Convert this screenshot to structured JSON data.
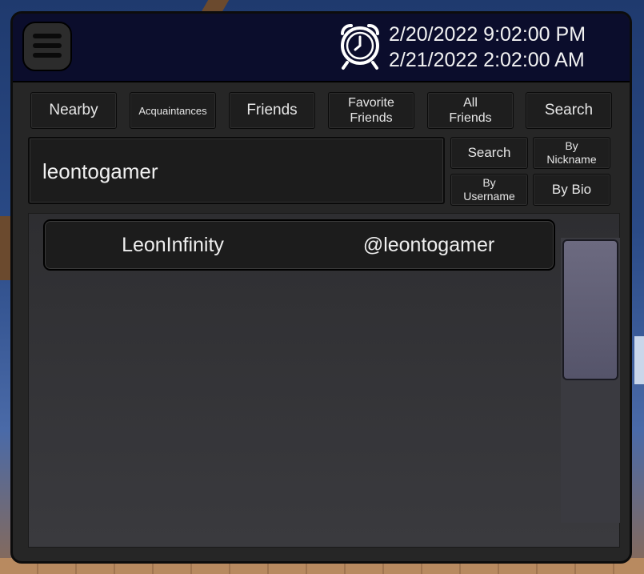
{
  "header": {
    "date_line_1": "2/20/2022 9:02:00 PM",
    "date_line_2": "2/21/2022 2:02:00 AM",
    "menu_icon": "hamburger-menu-icon",
    "clock_icon": "alarm-clock-icon"
  },
  "tabs": {
    "nearby": "Nearby",
    "acquaintances": "Acquaintances",
    "friends": "Friends",
    "favorite_friends_1": "Favorite",
    "favorite_friends_2": "Friends",
    "all_friends_1": "All",
    "all_friends_2": "Friends",
    "search": "Search"
  },
  "search": {
    "value": "leontogamer",
    "search_button": "Search",
    "by_nickname_1": "By",
    "by_nickname_2": "Nickname",
    "by_username_1": "By",
    "by_username_2": "Username",
    "by_bio": "By Bio"
  },
  "results": [
    {
      "nickname": "LeonInfinity",
      "username": "@leontogamer"
    }
  ],
  "colors": {
    "header_bg": "#0b0d2c",
    "panel_bg": "#262626",
    "button_bg": "#1e1e1e",
    "scroll_thumb": "#6c6a80"
  }
}
